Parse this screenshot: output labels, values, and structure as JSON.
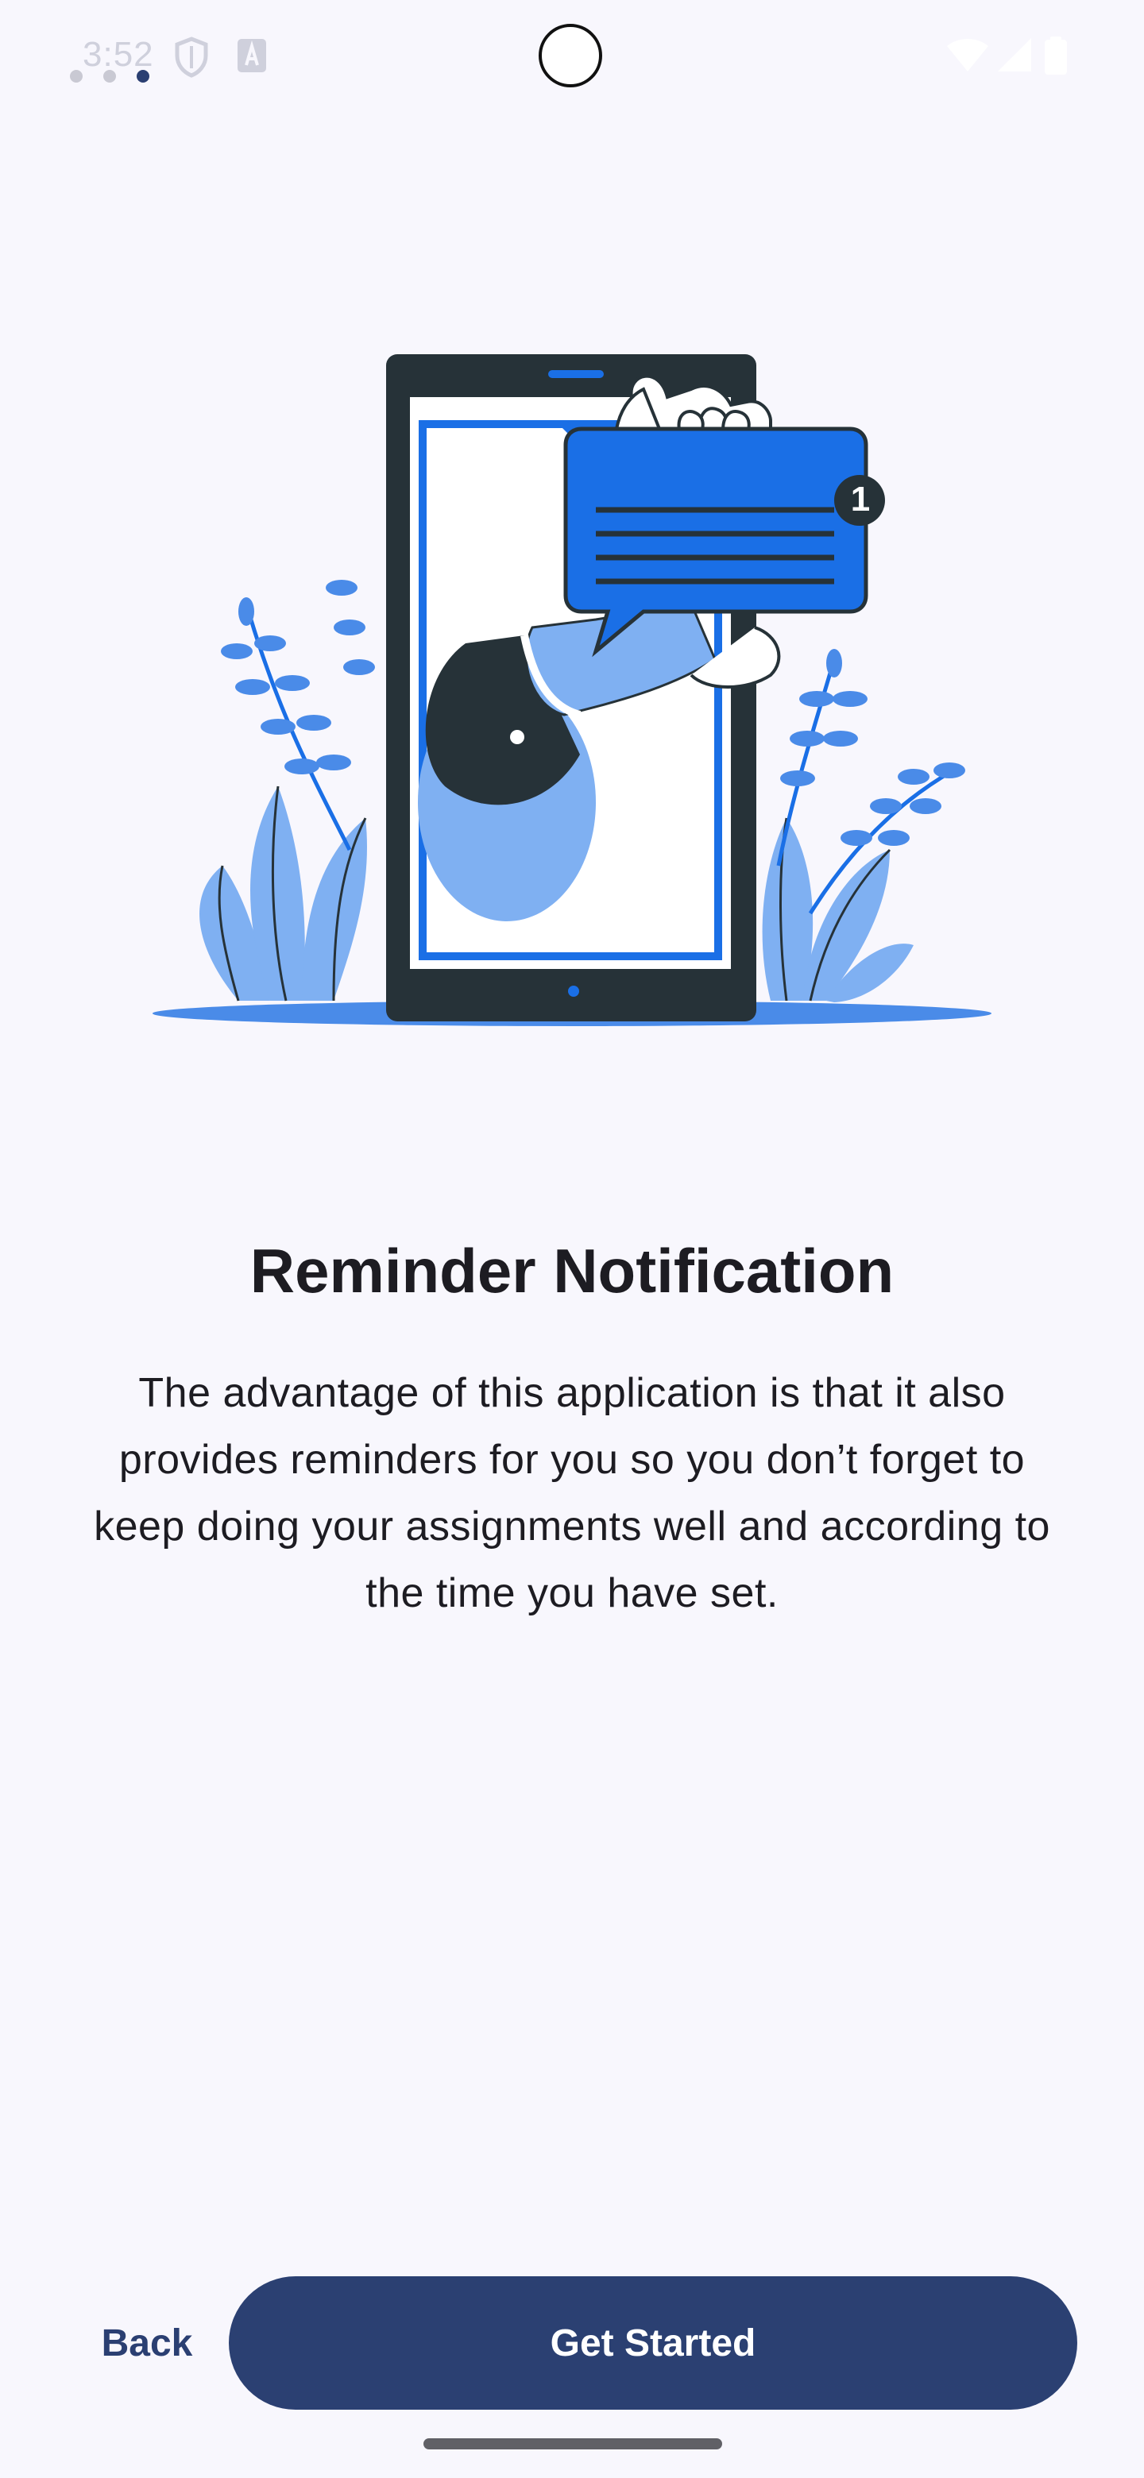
{
  "status_bar": {
    "time": "3:52",
    "icons": [
      "shield-icon",
      "notification-a-icon",
      "wifi-icon",
      "signal-icon",
      "battery-icon"
    ]
  },
  "onboarding": {
    "total_pages": 3,
    "current_page": 3,
    "title": "Reminder Notification",
    "description": "The advantage of this application is that it also provides reminders for you so you don’t forget to keep doing your assignments well and according to the time you have set.",
    "illustration": {
      "icon": "phone-notification-illustration",
      "badge_count": "1"
    }
  },
  "actions": {
    "back_label": "Back",
    "get_started_label": "Get Started"
  },
  "colors": {
    "primary": "#2b4072",
    "accent_blue": "#1a6fe6",
    "light_blue": "#7fb0f2",
    "dark": "#263238",
    "background": "#f8f7fd"
  }
}
